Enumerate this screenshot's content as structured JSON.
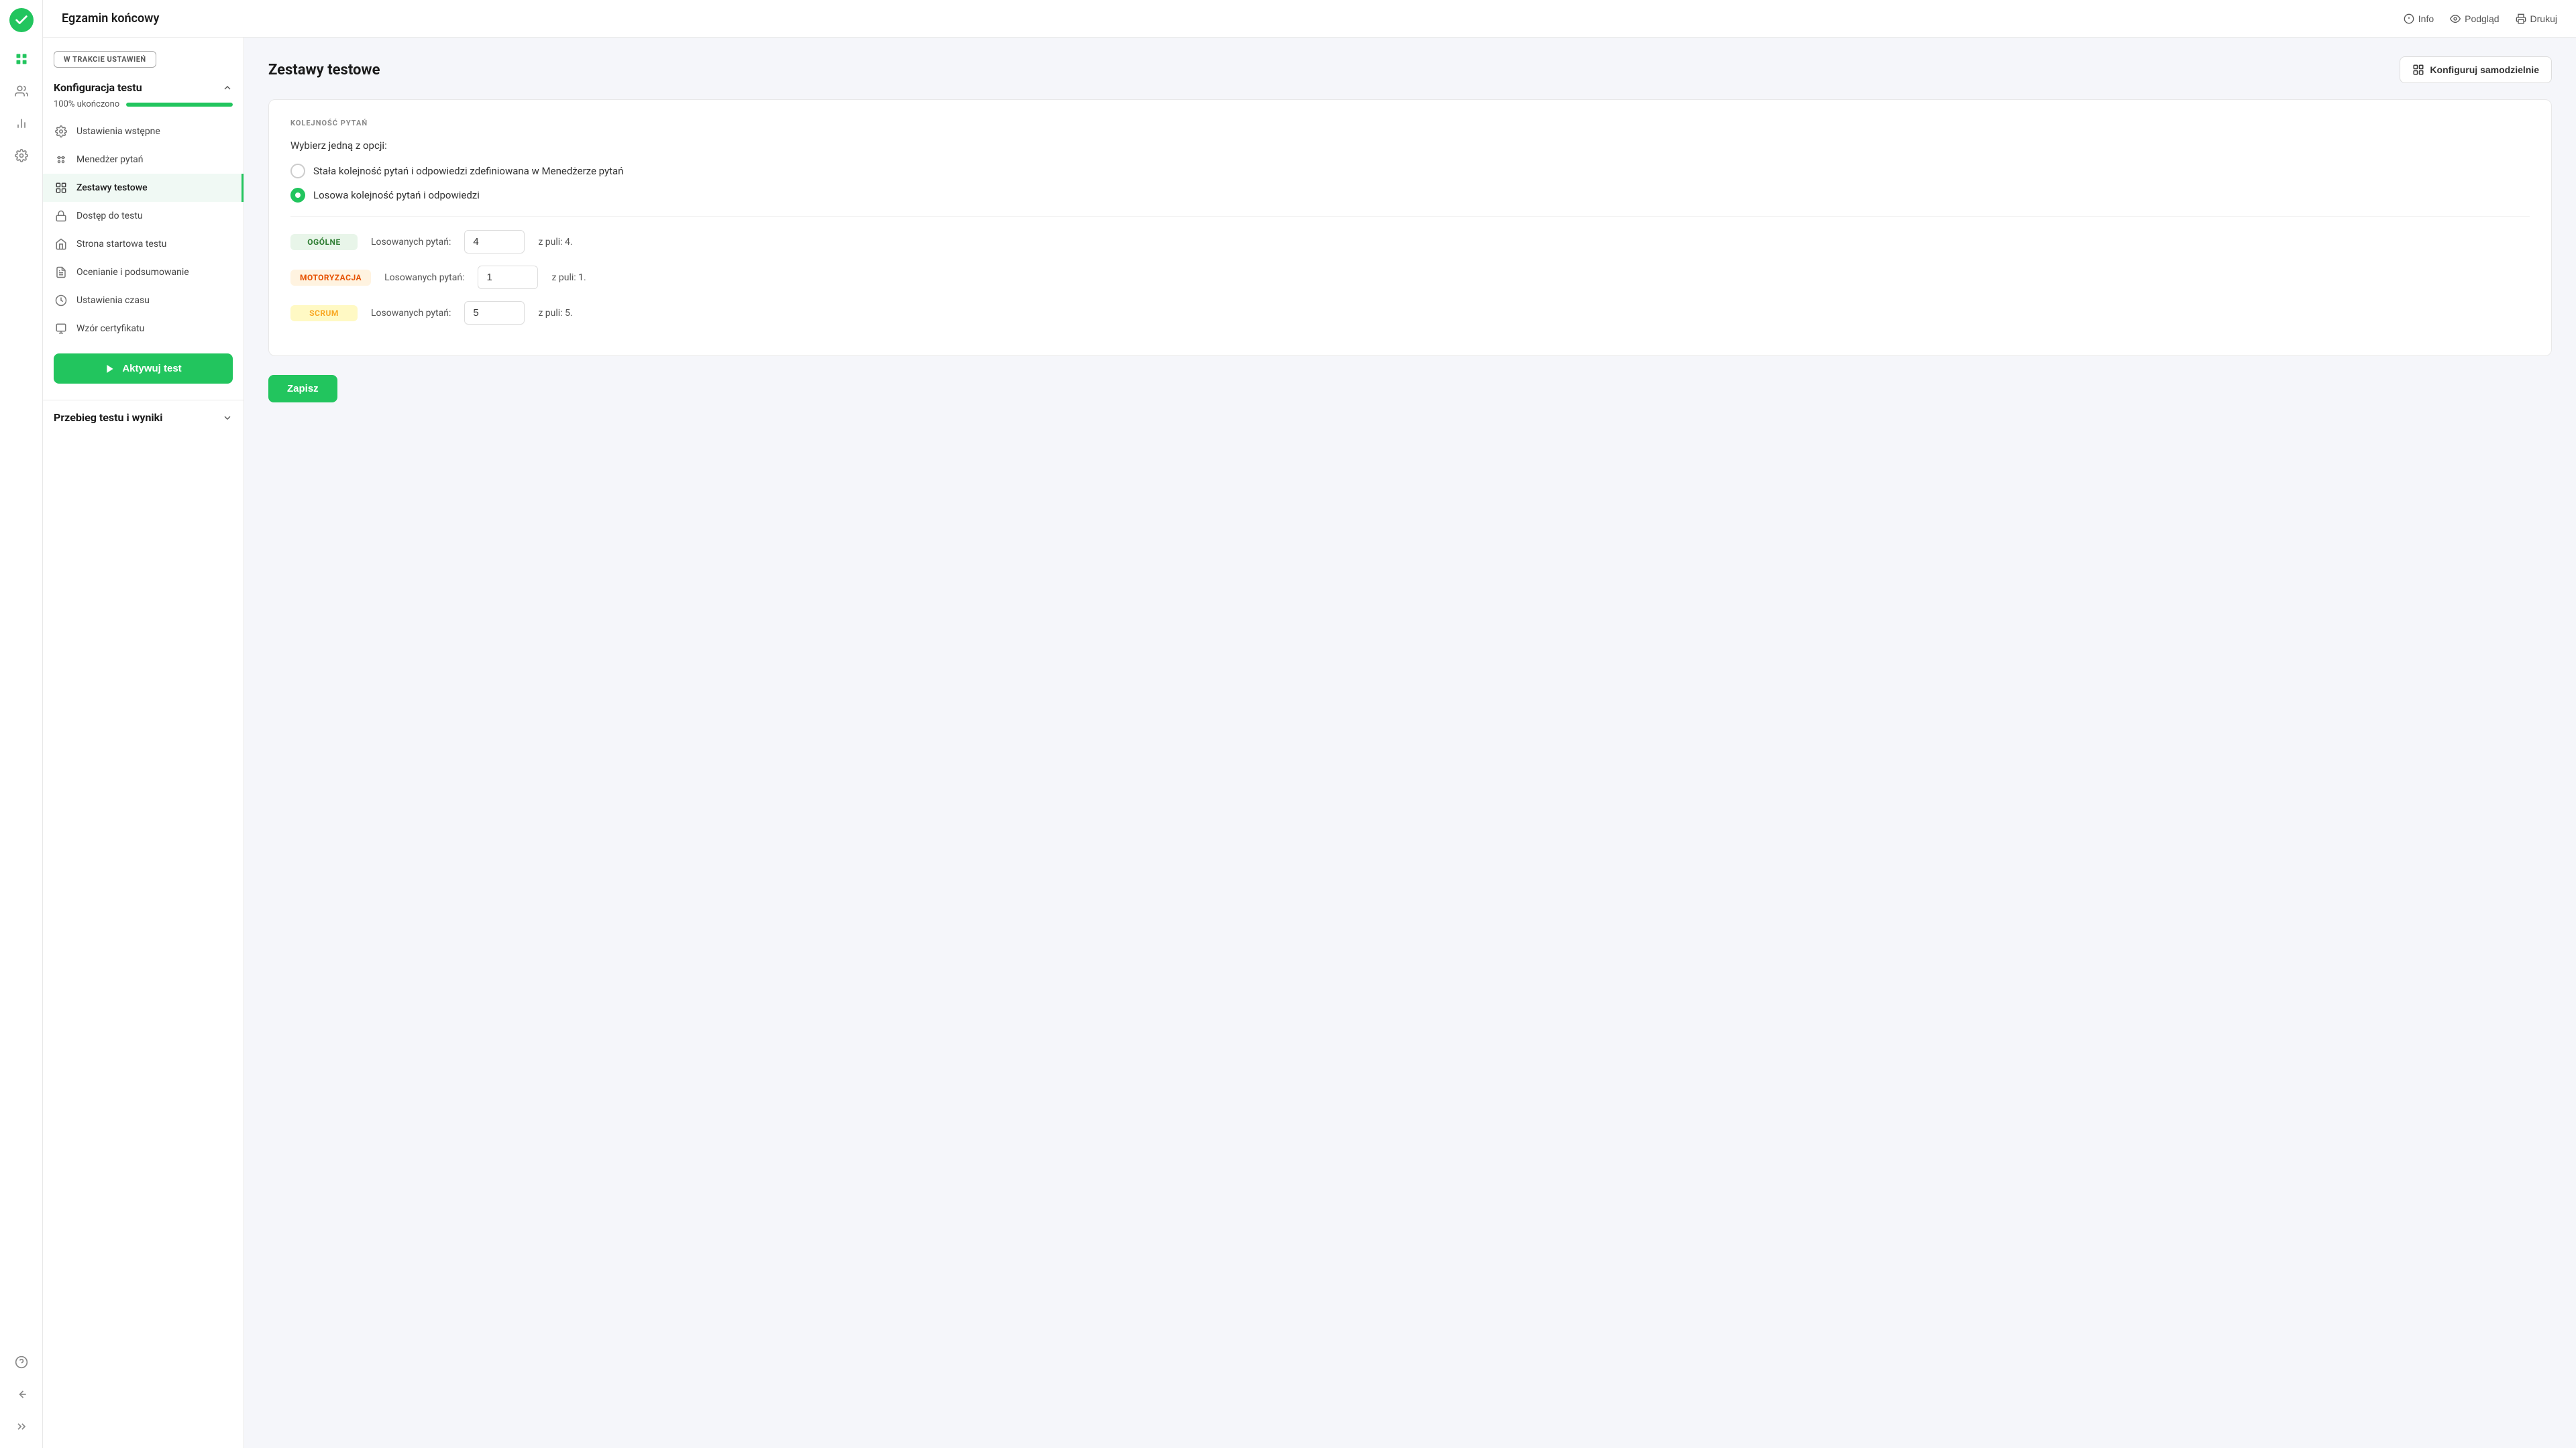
{
  "app": {
    "logo_aria": "App Logo",
    "title": "Egzamin końcowy"
  },
  "header": {
    "title": "Egzamin końcowy",
    "actions": {
      "info": "Info",
      "preview": "Podgląd",
      "print": "Drukuj"
    }
  },
  "sidebar": {
    "status_badge": "W TRAKCIE USTAWIEŃ",
    "konfiguracja": {
      "title": "Konfiguracja testu",
      "progress_label": "100% ukończono",
      "progress_value": 100
    },
    "nav_items": [
      {
        "id": "ustawienia-wstepne",
        "label": "Ustawienia wstępne",
        "active": false
      },
      {
        "id": "menedzer-pytan",
        "label": "Menedżer pytań",
        "active": false
      },
      {
        "id": "zestawy-testowe",
        "label": "Zestawy testowe",
        "active": true
      },
      {
        "id": "dostep-do-testu",
        "label": "Dostęp do testu",
        "active": false
      },
      {
        "id": "strona-startowa-testu",
        "label": "Strona startowa testu",
        "active": false
      },
      {
        "id": "ocenianie-i-podsumowanie",
        "label": "Ocenianie i podsumowanie",
        "active": false
      },
      {
        "id": "ustawienia-czasu",
        "label": "Ustawienia czasu",
        "active": false
      },
      {
        "id": "wzor-certyfikatu",
        "label": "Wzór certyfikatu",
        "active": false
      }
    ],
    "activate_btn": "Aktywuj test",
    "przebieg": {
      "title": "Przebieg testu i wyniki"
    }
  },
  "main": {
    "page_title": "Zestawy testowe",
    "configure_btn": "Konfiguruj samodzielnie",
    "section_label": "KOLEJNOŚĆ PYTAŃ",
    "choose_label": "Wybierz jedną z opcji:",
    "radio_options": [
      {
        "id": "stala",
        "label": "Stała kolejność pytań i odpowiedzi zdefiniowana w Menedżerze pytań",
        "checked": false
      },
      {
        "id": "losowa",
        "label": "Losowa kolejność pytań i odpowiedzi",
        "checked": true
      }
    ],
    "categories": [
      {
        "id": "ogolne",
        "badge": "OGÓLNE",
        "badge_class": "badge-ogolne",
        "row_label": "Losowanych pytań:",
        "value": "4",
        "pool": "z puli: 4."
      },
      {
        "id": "motoryzacja",
        "badge": "MOTORYZACJA",
        "badge_class": "badge-motoryzacja",
        "row_label": "Losowanych pytań:",
        "value": "1",
        "pool": "z puli: 1."
      },
      {
        "id": "scrum",
        "badge": "SCRUM",
        "badge_class": "badge-scrum",
        "row_label": "Losowanych pytań:",
        "value": "5",
        "pool": "z puli: 5."
      }
    ],
    "save_btn": "Zapisz"
  },
  "icons": {
    "check": "✓",
    "chevron_up": "▲",
    "chevron_down": "▼",
    "play": "▶",
    "grid": "⊞",
    "users": "👥",
    "chart": "📊",
    "gear": "⚙",
    "info": "ⓘ",
    "eye": "👁",
    "printer": "🖨",
    "configure": "⊞",
    "lock": "🔒",
    "home": "⌂",
    "document": "📄",
    "clock": "🕐",
    "certificate": "🏅",
    "help": "?",
    "back": "←",
    "expand": ">>"
  }
}
